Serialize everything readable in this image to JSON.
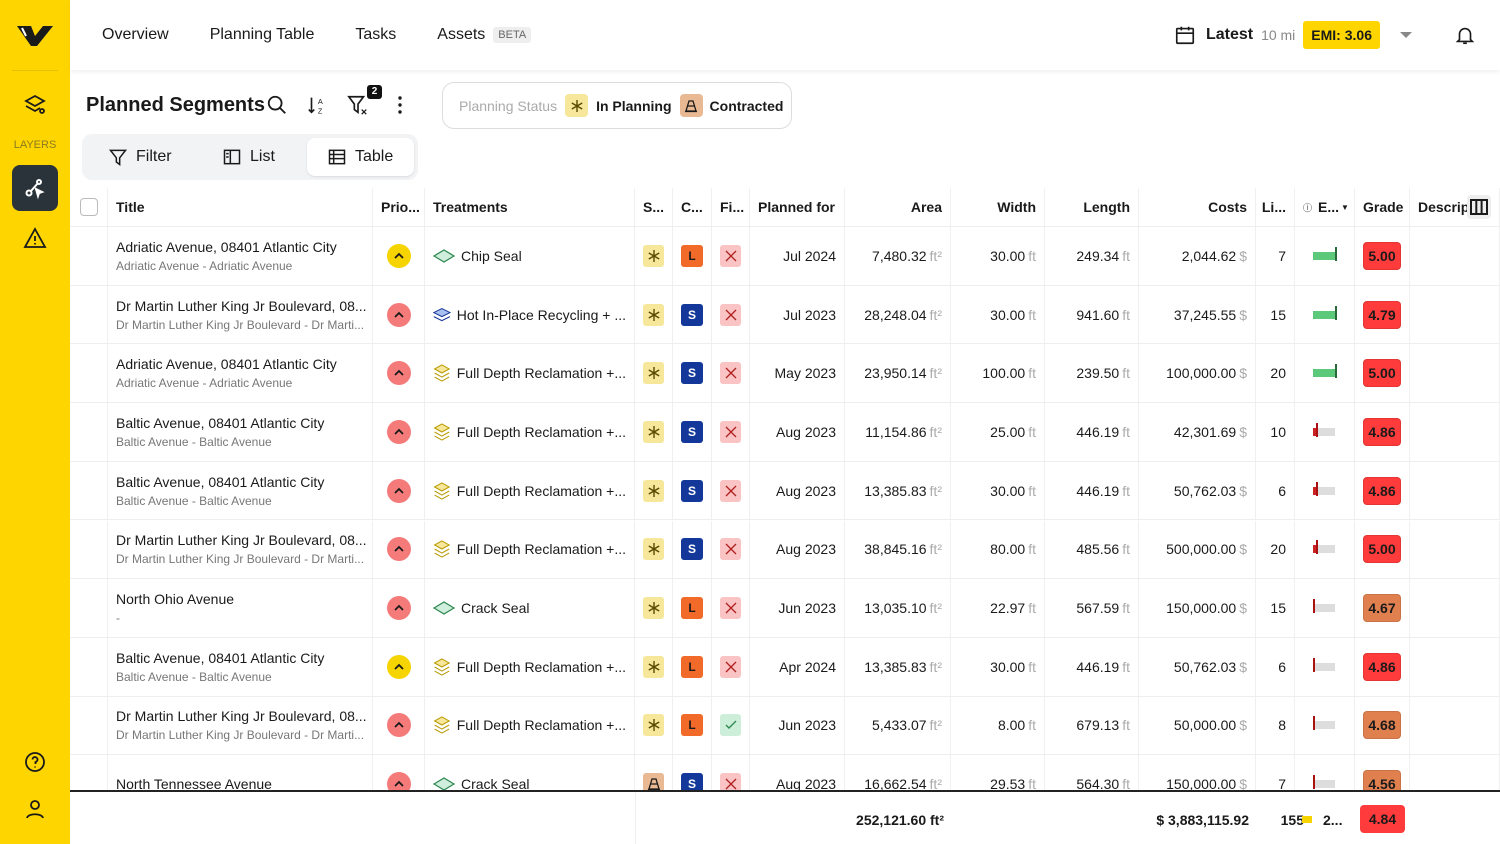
{
  "sidebar": {
    "layers_label": "LAYERS",
    "icons": [
      "layers-settings-icon",
      "segment-select-icon",
      "warning-icon",
      "help-icon",
      "user-icon"
    ]
  },
  "nav": {
    "items": [
      "Overview",
      "Planning Table",
      "Tasks",
      "Assets"
    ],
    "beta": "BETA",
    "latest": "Latest",
    "distance": "10 mi",
    "emi": "EMI: 3.06"
  },
  "panel": {
    "title": "Planned Segments",
    "filter_count": "2",
    "status_label": "Planning Status",
    "status_in_planning": "In Planning",
    "status_contracted": "Contracted",
    "views": [
      "Filter",
      "List",
      "Table"
    ]
  },
  "colors": {
    "brand": "#ffd500",
    "grade_red": "#ff3b3b",
    "grade_orange": "#e0804f",
    "sev_green": "#5cc87a",
    "sev_red": "#cc2222"
  },
  "table": {
    "headers": [
      "Title",
      "Prio...",
      "Treatments",
      "S...",
      "C...",
      "Fi...",
      "Planned for",
      "Area",
      "Width",
      "Length",
      "Costs",
      "Li...",
      "E...",
      "Grade",
      "Descrip"
    ],
    "rows": [
      {
        "title": "Adriatic Avenue, 08401 Atlantic City",
        "sub": "Adriatic Avenue - Adriatic Avenue",
        "prio": "yellow",
        "treat": "Chip Seal",
        "ticon": "chip",
        "status": "in-planning",
        "c": "L",
        "fi": "x",
        "planned": "Jul 2024",
        "area": "7,480.32",
        "width": "30.00",
        "length": "249.34",
        "cost": "2,044.62",
        "li": "7",
        "e": 1.0,
        "ecol": "green",
        "grade": "5.00",
        "gcol": "red"
      },
      {
        "title": "Dr Martin Luther King Jr Boulevard, 08...",
        "sub": "Dr Martin Luther King Jr Boulevard - Dr Marti...",
        "prio": "red",
        "treat": "Hot In-Place Recycling + ...",
        "ticon": "hot",
        "status": "in-planning",
        "c": "S",
        "fi": "x",
        "planned": "Jul 2023",
        "area": "28,248.04",
        "width": "30.00",
        "length": "941.60",
        "cost": "37,245.55",
        "li": "15",
        "e": 1.0,
        "ecol": "green",
        "grade": "4.79",
        "gcol": "red"
      },
      {
        "title": "Adriatic Avenue, 08401 Atlantic City",
        "sub": "Adriatic Avenue - Adriatic Avenue",
        "prio": "red",
        "treat": "Full Depth Reclamation +...",
        "ticon": "fdr",
        "status": "in-planning",
        "c": "S",
        "fi": "x",
        "planned": "May 2023",
        "area": "23,950.14",
        "width": "100.00",
        "length": "239.50",
        "cost": "100,000.00",
        "li": "20",
        "e": 1.0,
        "ecol": "green",
        "grade": "5.00",
        "gcol": "red"
      },
      {
        "title": "Baltic Avenue, 08401 Atlantic City",
        "sub": "Baltic Avenue - Baltic Avenue",
        "prio": "red",
        "treat": "Full Depth Reclamation +...",
        "ticon": "fdr",
        "status": "in-planning",
        "c": "S",
        "fi": "x",
        "planned": "Aug 2023",
        "area": "11,154.86",
        "width": "25.00",
        "length": "446.19",
        "cost": "42,301.69",
        "li": "10",
        "e": 0.15,
        "ecol": "red",
        "grade": "4.86",
        "gcol": "red"
      },
      {
        "title": "Baltic Avenue, 08401 Atlantic City",
        "sub": "Baltic Avenue - Baltic Avenue",
        "prio": "red",
        "treat": "Full Depth Reclamation +...",
        "ticon": "fdr",
        "status": "in-planning",
        "c": "S",
        "fi": "x",
        "planned": "Aug 2023",
        "area": "13,385.83",
        "width": "30.00",
        "length": "446.19",
        "cost": "50,762.03",
        "li": "6",
        "e": 0.15,
        "ecol": "red",
        "grade": "4.86",
        "gcol": "red"
      },
      {
        "title": "Dr Martin Luther King Jr Boulevard, 08...",
        "sub": "Dr Martin Luther King Jr Boulevard - Dr Marti...",
        "prio": "red",
        "treat": "Full Depth Reclamation +...",
        "ticon": "fdr",
        "status": "in-planning",
        "c": "S",
        "fi": "x",
        "planned": "Aug 2023",
        "area": "38,845.16",
        "width": "80.00",
        "length": "485.56",
        "cost": "500,000.00",
        "li": "20",
        "e": 0.15,
        "ecol": "red",
        "grade": "5.00",
        "gcol": "red"
      },
      {
        "title": "North Ohio Avenue",
        "sub": "-",
        "prio": "red",
        "treat": "Crack Seal",
        "ticon": "chip",
        "status": "in-planning",
        "c": "L",
        "fi": "x",
        "planned": "Jun 2023",
        "area": "13,035.10",
        "width": "22.97",
        "length": "567.59",
        "cost": "150,000.00",
        "li": "15",
        "e": 0,
        "ecol": "red",
        "grade": "4.67",
        "gcol": "orange"
      },
      {
        "title": "Baltic Avenue, 08401 Atlantic City",
        "sub": "Baltic Avenue - Baltic Avenue",
        "prio": "yellow",
        "treat": "Full Depth Reclamation +...",
        "ticon": "fdr",
        "status": "in-planning",
        "c": "L",
        "fi": "x",
        "planned": "Apr 2024",
        "area": "13,385.83",
        "width": "30.00",
        "length": "446.19",
        "cost": "50,762.03",
        "li": "6",
        "e": 0,
        "ecol": "red",
        "grade": "4.86",
        "gcol": "red"
      },
      {
        "title": "Dr Martin Luther King Jr Boulevard, 08...",
        "sub": "Dr Martin Luther King Jr Boulevard - Dr Marti...",
        "prio": "red",
        "treat": "Full Depth Reclamation +...",
        "ticon": "fdr",
        "status": "in-planning",
        "c": "L",
        "fi": "check",
        "planned": "Jun 2023",
        "area": "5,433.07",
        "width": "8.00",
        "length": "679.13",
        "cost": "50,000.00",
        "li": "8",
        "e": 0,
        "ecol": "red",
        "grade": "4.68",
        "gcol": "orange"
      },
      {
        "title": "North Tennessee Avenue",
        "sub": "",
        "prio": "red",
        "treat": "Crack Seal",
        "ticon": "chip",
        "status": "contracted",
        "c": "S",
        "fi": "x",
        "planned": "Aug 2023",
        "area": "16,662.54",
        "width": "29.53",
        "length": "564.30",
        "cost": "150,000.00",
        "li": "7",
        "e": 0,
        "ecol": "red",
        "grade": "4.56",
        "gcol": "orange"
      }
    ],
    "units": {
      "area": "ft²",
      "len": "ft",
      "cost": "$"
    },
    "footer": {
      "area": "252,121.60 ft²",
      "cost": "$ 3,883,115.92",
      "li": "155",
      "e": "2...",
      "grade": "4.84"
    }
  }
}
